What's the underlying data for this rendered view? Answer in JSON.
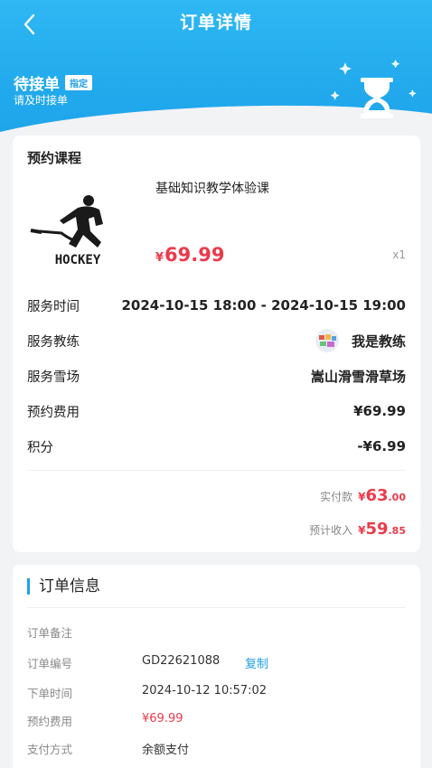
{
  "header": {
    "title": "订单详情",
    "back_icon": "back-chevron-icon"
  },
  "status": {
    "title": "待接单",
    "tag": "指定",
    "subtitle": "请及时接单",
    "icon": "hourglass-icon"
  },
  "course": {
    "section_title": "预约课程",
    "name": "基础知识教学体验课",
    "currency": "¥",
    "price": "69.99",
    "qty": "x1",
    "image_text": "HOCKEY"
  },
  "details": [
    {
      "label": "服务时间",
      "value": "2024-10-15 18:00 - 2024-10-15 19:00"
    },
    {
      "label": "服务教练",
      "value": "我是教练"
    },
    {
      "label": "服务雪场",
      "value": "嵩山滑雪滑草场"
    },
    {
      "label": "预约费用",
      "value": "¥69.99"
    },
    {
      "label": "积分",
      "value": "-¥6.99"
    }
  ],
  "payment": {
    "paid_label": "实付款",
    "paid_currency": "¥",
    "paid_int": "63",
    "paid_dec": ".00",
    "income_label": "预计收入",
    "income_currency": "¥",
    "income_int": "59",
    "income_dec": ".85"
  },
  "order_info": {
    "title": "订单信息",
    "rows": [
      {
        "label": "订单备注",
        "value": ""
      },
      {
        "label": "订单编号",
        "value": "GD22621088",
        "action": "复制"
      },
      {
        "label": "下单时间",
        "value": "2024-10-12 10:57:02"
      },
      {
        "label": "预约费用",
        "value": "¥69.99"
      },
      {
        "label": "支付方式",
        "value": "余额支付"
      }
    ]
  },
  "colors": {
    "primary": "#1fa2ea",
    "price": "#ea3b4c"
  }
}
